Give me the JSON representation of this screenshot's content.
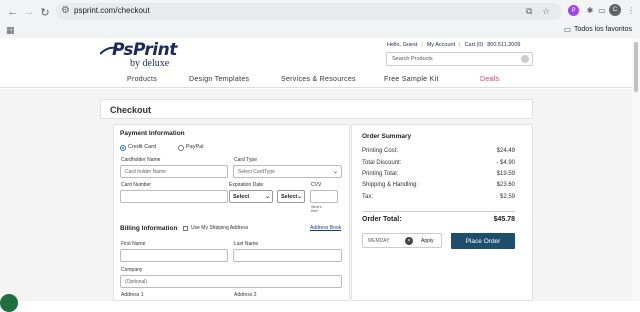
{
  "browser": {
    "url": "psprint.com/checkout",
    "profile_initial": "P",
    "avatar_initial": "C",
    "bookmarks_folder": "Todos los favoritos"
  },
  "site": {
    "logo_main": "PsPrint",
    "logo_sub": "by deluxe",
    "greeting": "Hello, Guest",
    "my_account": "My Account",
    "cart": "Cart (0)",
    "phone": "800.511.2009",
    "search_placeholder": "Search Products",
    "nav": [
      "Products",
      "Design Templates",
      "Services & Resources",
      "Free Sample Kit",
      "Deals"
    ]
  },
  "page": {
    "title": "Checkout"
  },
  "payment": {
    "title": "Payment Information",
    "option_card": "Credit Card",
    "option_paypal": "PayPal",
    "cardholder_label": "Cardholder Name",
    "cardholder_placeholder": "Card holder Name",
    "cardtype_label": "Card Type",
    "cardtype_placeholder": "Select CardType",
    "cardnumber_label": "Card Number",
    "expiration_label": "Expiration Date",
    "month_select": "Select",
    "year_select": "Select",
    "cvv_label": "CVV",
    "cvv_help": "What's this?"
  },
  "billing": {
    "title": "Billing Information",
    "use_shipping": "Use My Shipping Address",
    "address_book": "Address Book",
    "first_name_label": "First Name",
    "last_name_label": "Last Name",
    "company_label": "Company",
    "company_placeholder": "(Optional)",
    "address1_label": "Address 1",
    "address2_label": "Address 2"
  },
  "summary": {
    "title": "Order Summary",
    "rows": [
      {
        "label": "Printing Cost:",
        "value": "$24.49"
      },
      {
        "label": "Total Discount:",
        "value": "- $4.90"
      },
      {
        "label": "Printing Total:",
        "value": "$19.59"
      },
      {
        "label": "Shipping & Handling:",
        "value": "$23.60"
      },
      {
        "label": "Tax:",
        "value": "$2.59"
      }
    ],
    "total_label": "Order Total:",
    "total_value": "$45.78",
    "promo_code": "MEMDAY",
    "apply_label": "Apply",
    "place_order": "Place Order"
  }
}
